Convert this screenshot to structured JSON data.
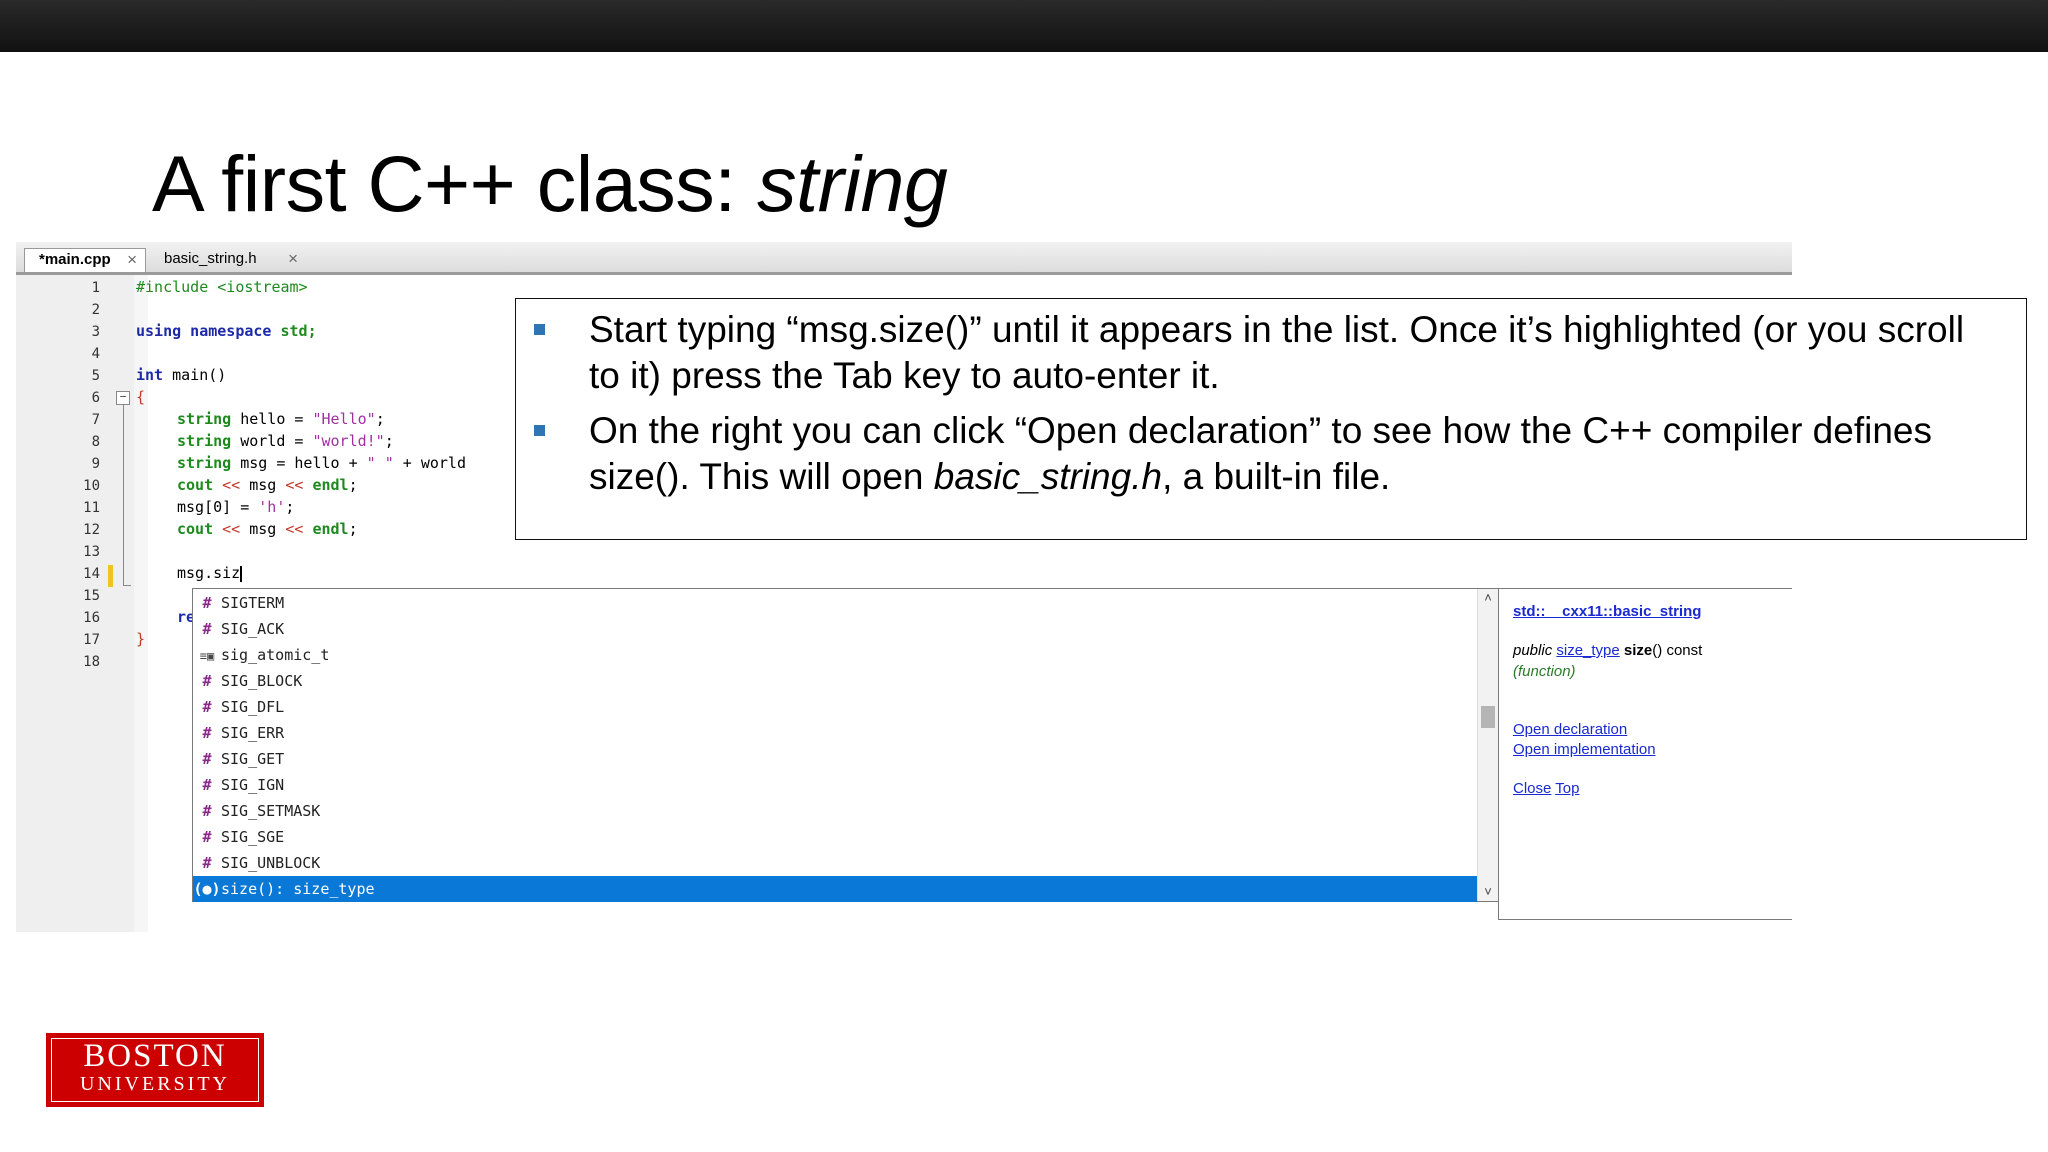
{
  "slide": {
    "title_main": "A first C++ class: ",
    "title_italic": "string"
  },
  "editor": {
    "tabs": [
      {
        "label": "*main.cpp",
        "close": "×"
      },
      {
        "label": "basic_string.h",
        "close": "×"
      }
    ],
    "line_numbers": [
      "1",
      "2",
      "3",
      "4",
      "5",
      "6",
      "7",
      "8",
      "9",
      "10",
      "11",
      "12",
      "13",
      "14",
      "15",
      "16",
      "17",
      "18"
    ],
    "code": {
      "l1": "#include <iostream>",
      "l3_kw": "using namespace",
      "l3_rest": " std;",
      "l5_kw": "int",
      "l5_rest": " main()",
      "l6": "{",
      "l7_type": "string",
      "l7_rest": " hello = ",
      "l7_str": "\"Hello\"",
      "l7_end": ";",
      "l8_type": "string",
      "l8_rest": " world = ",
      "l8_str": "\"world!\"",
      "l8_end": ";",
      "l9_type": "string",
      "l9_rest": " msg = hello + ",
      "l9_str": "\" \"",
      "l9_end": " + world",
      "l10_a": "cout",
      "l10_b": " << ",
      "l10_c": "msg",
      "l10_d": " << ",
      "l10_e": "endl",
      "l10_f": ";",
      "l11_a": "msg[0] = ",
      "l11_str": "'h'",
      "l11_end": ";",
      "l12_a": "cout",
      "l12_b": " << ",
      "l12_c": "msg",
      "l12_d": " << ",
      "l12_e": "endl",
      "l12_f": ";",
      "l14": "msg.siz",
      "l16": "re",
      "l17": "}"
    },
    "fold_symbol": "−"
  },
  "autocomplete": {
    "items": [
      {
        "icon": "#",
        "label": "SIGTERM"
      },
      {
        "icon": "#",
        "label": "SIG_ACK"
      },
      {
        "icon": "≡▣",
        "label": "sig_atomic_t"
      },
      {
        "icon": "#",
        "label": "SIG_BLOCK"
      },
      {
        "icon": "#",
        "label": "SIG_DFL"
      },
      {
        "icon": "#",
        "label": "SIG_ERR"
      },
      {
        "icon": "#",
        "label": "SIG_GET"
      },
      {
        "icon": "#",
        "label": "SIG_IGN"
      },
      {
        "icon": "#",
        "label": "SIG_SETMASK"
      },
      {
        "icon": "#",
        "label": "SIG_SGE"
      },
      {
        "icon": "#",
        "label": "SIG_UNBLOCK"
      },
      {
        "icon": "(●)",
        "label": "size(): size_type"
      }
    ],
    "selected_index": 11,
    "scroll_up": "˄",
    "scroll_down": "˅",
    "selection_color": "#0a78d7"
  },
  "info_panel": {
    "header": "std::__cxx11::basic_string",
    "sig_public": "public",
    "sig_type": "size_type",
    "sig_name": "size",
    "sig_rest": "() const",
    "kind": "(function)",
    "open_declaration": "Open declaration",
    "open_implementation": "Open implementation",
    "close": "Close",
    "top": "Top"
  },
  "note": {
    "bullet1": "Start typing “msg.size()” until it appears in the list.  Once it’s highlighted (or you scroll to it) press the Tab key to auto-enter it.",
    "bullet2_a": "On the right you can click “Open declaration” to see how the C++ compiler defines size().  This will open ",
    "bullet2_italic": "basic_string.h",
    "bullet2_b": ", a built-in file.",
    "bullet_color": "#2e75b6"
  },
  "logo": {
    "line1": "BOSTON",
    "line2": "UNIVERSITY",
    "color": "#cc0000"
  }
}
